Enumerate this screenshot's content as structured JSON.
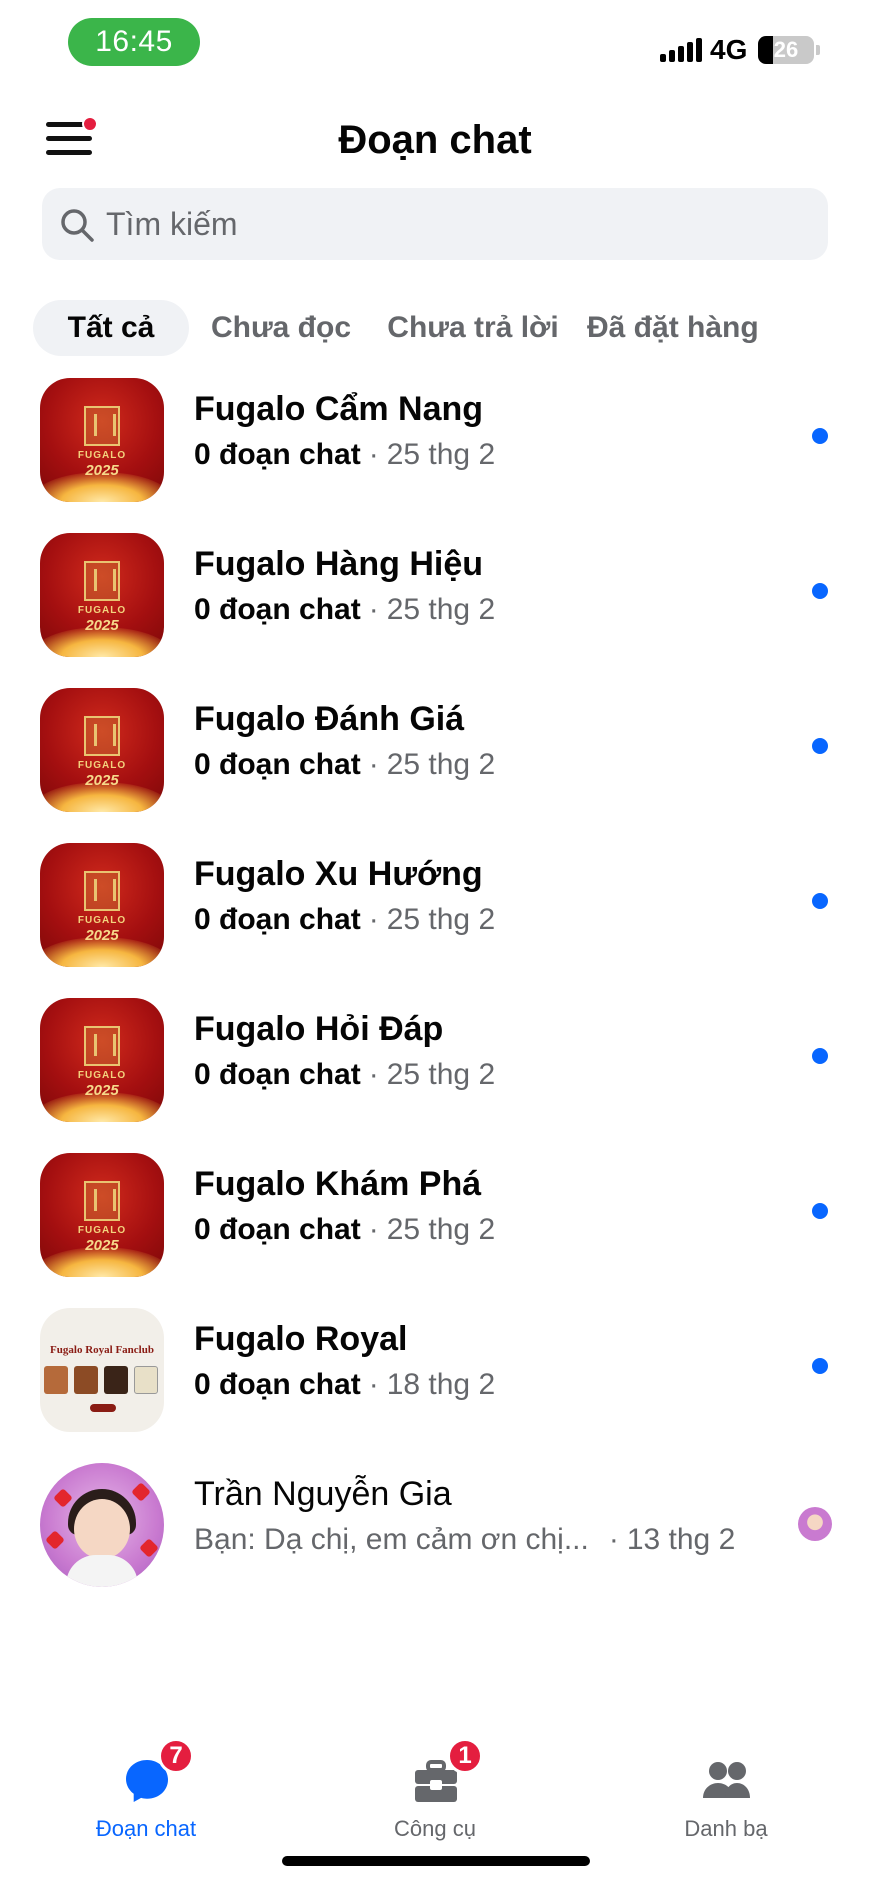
{
  "status_bar": {
    "time": "16:45",
    "network": "4G",
    "battery_level": "26",
    "time_pill_color": "#3bb54a"
  },
  "header": {
    "title": "Đoạn chat",
    "menu_icon": "hamburger-menu-icon",
    "menu_has_notification": true
  },
  "search": {
    "placeholder": "Tìm kiếm",
    "icon": "search-icon"
  },
  "filter_tabs": [
    {
      "label": "Tất cả",
      "active": true
    },
    {
      "label": "Chưa đọc",
      "active": false
    },
    {
      "label": "Chưa trả lời",
      "active": false
    },
    {
      "label": "Đã đặt hàng",
      "active": false
    }
  ],
  "chats": [
    {
      "name": "Fugalo Cẩm Nang",
      "preview": "0 đoạn chat",
      "separator": "·",
      "date": "25 thg 2",
      "avatar_type": "fugalo-red",
      "unread": true
    },
    {
      "name": "Fugalo Hàng Hiệu",
      "preview": "0 đoạn chat",
      "separator": "·",
      "date": "25 thg 2",
      "avatar_type": "fugalo-red",
      "unread": true
    },
    {
      "name": "Fugalo Đánh Giá",
      "preview": "0 đoạn chat",
      "separator": "·",
      "date": "25 thg 2",
      "avatar_type": "fugalo-red",
      "unread": true
    },
    {
      "name": "Fugalo Xu Hướng",
      "preview": "0 đoạn chat",
      "separator": "·",
      "date": "25 thg 2",
      "avatar_type": "fugalo-red",
      "unread": true
    },
    {
      "name": "Fugalo Hỏi Đáp",
      "preview": "0 đoạn chat",
      "separator": "·",
      "date": "25 thg 2",
      "avatar_type": "fugalo-red",
      "unread": true
    },
    {
      "name": "Fugalo Khám Phá",
      "preview": "0 đoạn chat",
      "separator": "·",
      "date": "25 thg 2",
      "avatar_type": "fugalo-red",
      "unread": true
    },
    {
      "name": "Fugalo Royal",
      "preview": "0 đoạn chat",
      "separator": "·",
      "date": "18 thg 2",
      "avatar_type": "fugalo-royal",
      "unread": true
    },
    {
      "name": "Trần Nguyễn Gia",
      "preview": "Bạn: Dạ chị, em cảm ơn chị...",
      "separator": "·",
      "date": "13 thg 2",
      "avatar_type": "person",
      "unread": false
    }
  ],
  "avatar_text": {
    "fugalo_brand": "FUGALO",
    "fugalo_year": "2025",
    "royal_title": "Fugalo Royal Fanclub"
  },
  "bottom_nav": [
    {
      "label": "Đoạn chat",
      "icon": "chat-bubble-icon",
      "badge": "7",
      "active": true
    },
    {
      "label": "Công cụ",
      "icon": "toolbox-icon",
      "badge": "1",
      "active": false
    },
    {
      "label": "Danh bạ",
      "icon": "contacts-icon",
      "badge": "",
      "active": false
    }
  ],
  "colors": {
    "accent": "#0866ff",
    "badge": "#e41e3f",
    "secondary_text": "#65676b",
    "search_bg": "#f0f2f5"
  }
}
